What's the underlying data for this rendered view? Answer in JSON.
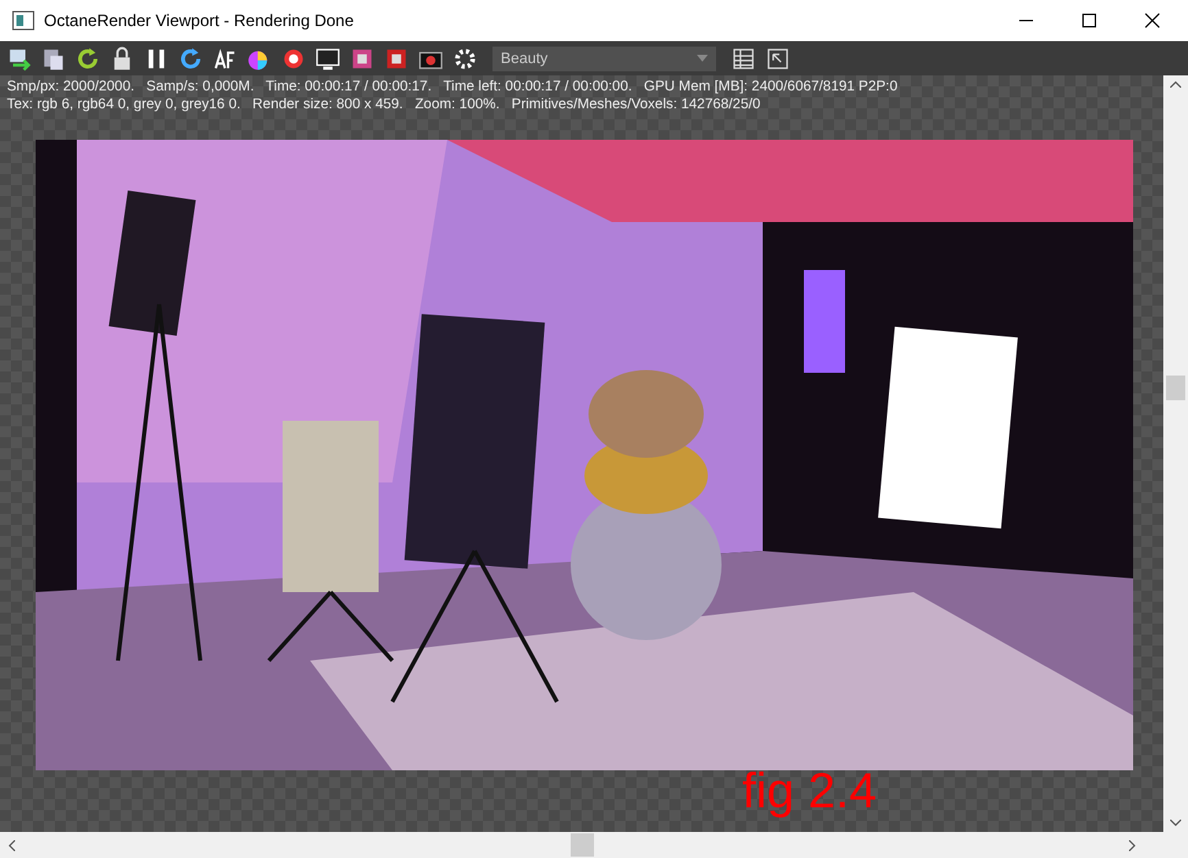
{
  "window": {
    "title": "OctaneRender Viewport - Rendering Done"
  },
  "toolbar": {
    "pass_dropdown": {
      "value": "Beauty"
    }
  },
  "stats": [
    "Smp/px: 2000/2000.   Samp/s: 0,000M.   Time: 00:00:17 / 00:00:17.   Time left: 00:00:17 / 00:00:00.   GPU Mem [MB]: 2400/6067/8191 P2P:0",
    "Tex: rgb 6, rgb64 0, grey 0, grey16 0.   Render size: 800 x 459.   Zoom: 100%.   Primitives/Meshes/Voxels: 142768/25/0"
  ],
  "caption": "fig 2.4"
}
